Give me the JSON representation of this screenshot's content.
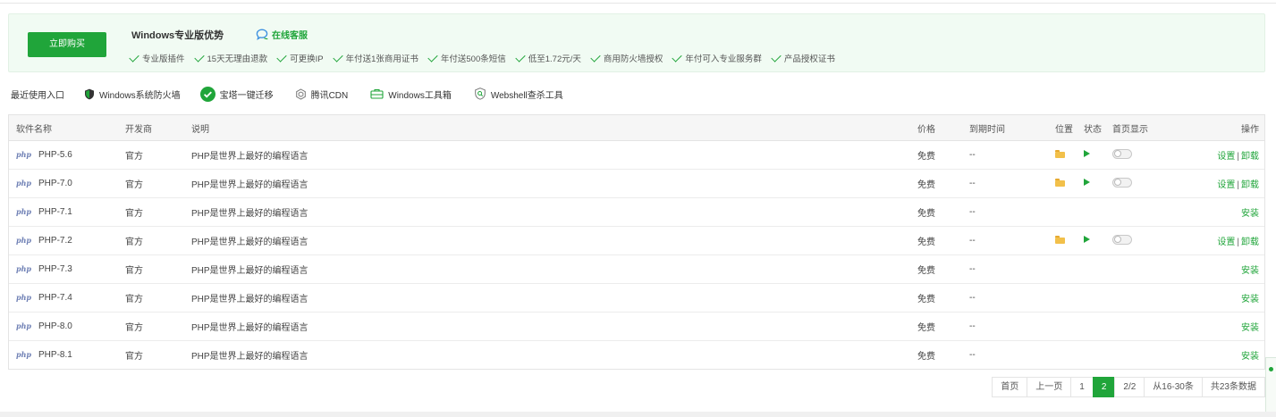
{
  "promo": {
    "buy_label": "立即购买",
    "title": "Windows专业版优势",
    "service_label": "在线客服",
    "benefits": [
      "专业版插件",
      "15天无理由退款",
      "可更换IP",
      "年付送1张商用证书",
      "年付送500条短信",
      "低至1.72元/天",
      "商用防火墙授权",
      "年付可入专业服务群",
      "产品授权证书"
    ]
  },
  "recent": {
    "label": "最近使用入口",
    "items": [
      "Windows系统防火墙",
      "宝塔一键迁移",
      "腾讯CDN",
      "Windows工具箱",
      "Webshell查杀工具"
    ]
  },
  "table": {
    "headers": {
      "name": "软件名称",
      "developer": "开发商",
      "desc": "说明",
      "price": "价格",
      "expire": "到期时间",
      "location": "位置",
      "status": "状态",
      "homepage": "首页显示",
      "action": "操作"
    },
    "logo_text": "php",
    "settings_label": "设置",
    "uninstall_label": "卸载",
    "install_label": "安装",
    "separator": "|",
    "rows": [
      {
        "name": "PHP-5.6",
        "developer": "官方",
        "desc": "PHP是世界上最好的编程语言",
        "price": "免费",
        "expire": "--",
        "installed": true
      },
      {
        "name": "PHP-7.0",
        "developer": "官方",
        "desc": "PHP是世界上最好的编程语言",
        "price": "免费",
        "expire": "--",
        "installed": true
      },
      {
        "name": "PHP-7.1",
        "developer": "官方",
        "desc": "PHP是世界上最好的编程语言",
        "price": "免费",
        "expire": "--",
        "installed": false
      },
      {
        "name": "PHP-7.2",
        "developer": "官方",
        "desc": "PHP是世界上最好的编程语言",
        "price": "免费",
        "expire": "--",
        "installed": true
      },
      {
        "name": "PHP-7.3",
        "developer": "官方",
        "desc": "PHP是世界上最好的编程语言",
        "price": "免费",
        "expire": "--",
        "installed": false
      },
      {
        "name": "PHP-7.4",
        "developer": "官方",
        "desc": "PHP是世界上最好的编程语言",
        "price": "免费",
        "expire": "--",
        "installed": false
      },
      {
        "name": "PHP-8.0",
        "developer": "官方",
        "desc": "PHP是世界上最好的编程语言",
        "price": "免费",
        "expire": "--",
        "installed": false
      },
      {
        "name": "PHP-8.1",
        "developer": "官方",
        "desc": "PHP是世界上最好的编程语言",
        "price": "免费",
        "expire": "--",
        "installed": false
      }
    ]
  },
  "pager": {
    "first": "首页",
    "prev": "上一页",
    "pages": [
      "1",
      "2"
    ],
    "current": "2",
    "page_count": "2/2",
    "range": "从16-30条",
    "total": "共23条数据"
  },
  "colors": {
    "accent": "#20a53a",
    "panel_bg": "#f1fbf3",
    "folder": "#f2c04a",
    "php": "#6f80b5"
  }
}
